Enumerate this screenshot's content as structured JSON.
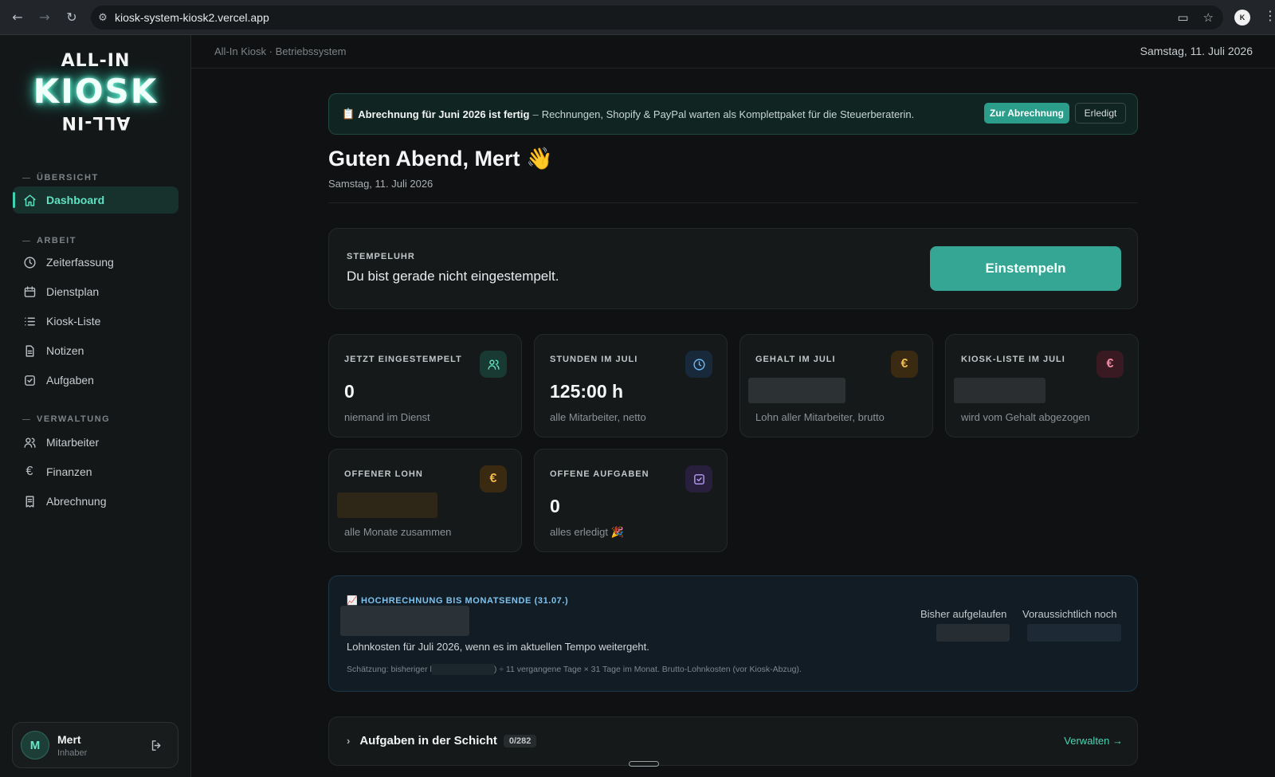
{
  "browser": {
    "url": "kiosk-system-kiosk2.vercel.app",
    "profile_initial": "K"
  },
  "logo": {
    "top_arc": "ALL-IN",
    "main": "KIOSK",
    "bottom_arc": "ALL-IN"
  },
  "sidebar": {
    "sections": [
      {
        "label": "ÜBERSICHT"
      },
      {
        "label": "ARBEIT"
      },
      {
        "label": "VERWALTUNG"
      }
    ],
    "items": [
      {
        "label": "Dashboard",
        "icon": "home-icon",
        "active": true
      },
      {
        "label": "Zeiterfassung",
        "icon": "clock-icon"
      },
      {
        "label": "Dienstplan",
        "icon": "calendar-icon"
      },
      {
        "label": "Kiosk-Liste",
        "icon": "list-icon"
      },
      {
        "label": "Notizen",
        "icon": "note-icon"
      },
      {
        "label": "Aufgaben",
        "icon": "checkbox-icon"
      },
      {
        "label": "Mitarbeiter",
        "icon": "users-icon"
      },
      {
        "label": "Finanzen",
        "icon": "euro-icon"
      },
      {
        "label": "Abrechnung",
        "icon": "receipt-icon"
      }
    ],
    "user": {
      "initial": "M",
      "name": "Mert",
      "role": "Inhaber"
    }
  },
  "topbar": {
    "breadcrumb": "All-In Kiosk · Betriebssystem",
    "date": "Samstag, 11. Juli 2026"
  },
  "banner": {
    "emoji": "📋",
    "title": "Abrechnung für Juni 2026 ist fertig",
    "separator": "–",
    "text": "Rechnungen, Shopify & PayPal warten als Komplettpaket für die Steuerberaterin.",
    "primary_button": "Zur Abrechnung",
    "secondary_button": "Erledigt"
  },
  "greeting": {
    "title": "Guten Abend, Mert 👋",
    "date": "Samstag, 11. Juli 2026"
  },
  "clock": {
    "label": "STEMPELUHR",
    "status": "Du bist gerade nicht eingestempelt.",
    "button": "Einstempeln"
  },
  "stats": [
    {
      "label": "JETZT EINGESTEMPELT",
      "value": "0",
      "sub": "niemand im Dienst",
      "icon": "users-icon"
    },
    {
      "label": "STUNDEN IM JULI",
      "value": "125:00 h",
      "sub": "alle Mitarbeiter, netto",
      "icon": "clock-icon"
    },
    {
      "label": "GEHALT IM JULI",
      "value": "",
      "sub": "Lohn aller Mitarbeiter, brutto",
      "icon": "euro-icon",
      "badge_glyph": "€"
    },
    {
      "label": "KIOSK-LISTE IM JULI",
      "value": "",
      "sub": "wird vom Gehalt abgezogen",
      "icon": "euro-icon",
      "badge_glyph": "€"
    },
    {
      "label": "OFFENER LOHN",
      "value": "",
      "sub": "alle Monate zusammen",
      "icon": "euro-icon",
      "badge_glyph": "€"
    },
    {
      "label": "OFFENE AUFGABEN",
      "value": "0",
      "sub": "alles erledigt 🎉",
      "icon": "checkbox-icon"
    }
  ],
  "projection": {
    "title": "📈 HOCHRECHNUNG BIS MONATSENDE (31.07.)",
    "description": "Lohnkosten für Juli 2026, wenn es im aktuellen Tempo weitergeht.",
    "note_prefix": "Schätzung: bisheriger l",
    "note_suffix": ") ÷ 11 vergangene Tage × 31 Tage im Monat. Brutto-Lohnkosten (vor Kiosk-Abzug).",
    "col1_label": "Bisher aufgelaufen",
    "col2_label": "Voraussichtlich noch"
  },
  "tasks": {
    "title": "Aufgaben in der Schicht",
    "count": "0/282",
    "manage": "Verwalten →"
  },
  "colors": {
    "accent": "#35a694",
    "accent_text": "#4fd3b3",
    "background": "#0f1112"
  }
}
